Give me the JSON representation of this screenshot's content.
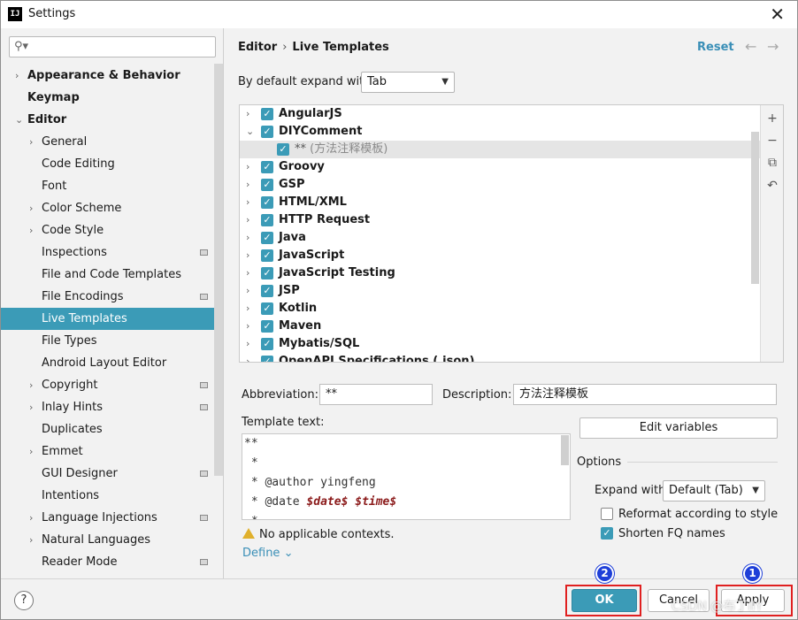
{
  "window": {
    "title": "Settings",
    "app_icon": "IJ"
  },
  "sidebar": {
    "search": {
      "placeholder": "",
      "value": ""
    },
    "items": [
      {
        "label": "Appearance & Behavior",
        "arrow": "›",
        "bold": true
      },
      {
        "label": "Keymap",
        "arrow": "",
        "bold": true
      },
      {
        "label": "Editor",
        "arrow": "⌄",
        "bold": true
      },
      {
        "label": "General",
        "arrow": "›"
      },
      {
        "label": "Code Editing",
        "arrow": ""
      },
      {
        "label": "Font",
        "arrow": ""
      },
      {
        "label": "Color Scheme",
        "arrow": "›"
      },
      {
        "label": "Code Style",
        "arrow": "›"
      },
      {
        "label": "Inspections",
        "arrow": ""
      },
      {
        "label": "File and Code Templates",
        "arrow": ""
      },
      {
        "label": "File Encodings",
        "arrow": ""
      },
      {
        "label": "Live Templates",
        "arrow": "",
        "selected": true
      },
      {
        "label": "File Types",
        "arrow": ""
      },
      {
        "label": "Android Layout Editor",
        "arrow": ""
      },
      {
        "label": "Copyright",
        "arrow": "›"
      },
      {
        "label": "Inlay Hints",
        "arrow": "›"
      },
      {
        "label": "Duplicates",
        "arrow": ""
      },
      {
        "label": "Emmet",
        "arrow": "›"
      },
      {
        "label": "GUI Designer",
        "arrow": ""
      },
      {
        "label": "Intentions",
        "arrow": ""
      },
      {
        "label": "Language Injections",
        "arrow": "›"
      },
      {
        "label": "Natural Languages",
        "arrow": "›"
      },
      {
        "label": "Reader Mode",
        "arrow": ""
      }
    ]
  },
  "header": {
    "crumb_parent": "Editor",
    "crumb_sep": "›",
    "crumb_current": "Live Templates",
    "reset": "Reset",
    "back_arrow": "←",
    "forward_arrow": "→"
  },
  "expand": {
    "label": "By default expand with",
    "value": "Tab",
    "caret": "▼"
  },
  "templates": [
    {
      "name": "AngularJS",
      "arrow": "›"
    },
    {
      "name": "DIYComment",
      "arrow": "⌄"
    },
    {
      "name": "**",
      "desc": " (方法注释模板)",
      "child": true
    },
    {
      "name": "Groovy",
      "arrow": "›"
    },
    {
      "name": "GSP",
      "arrow": "›"
    },
    {
      "name": "HTML/XML",
      "arrow": "›"
    },
    {
      "name": "HTTP Request",
      "arrow": "›"
    },
    {
      "name": "Java",
      "arrow": "›"
    },
    {
      "name": "JavaScript",
      "arrow": "›"
    },
    {
      "name": "JavaScript Testing",
      "arrow": "›"
    },
    {
      "name": "JSP",
      "arrow": "›"
    },
    {
      "name": "Kotlin",
      "arrow": "›"
    },
    {
      "name": "Maven",
      "arrow": "›"
    },
    {
      "name": "Mybatis/SQL",
      "arrow": "›"
    },
    {
      "name": "OpenAPI Specifications (.json)",
      "arrow": "›"
    }
  ],
  "tools": {
    "add": "+",
    "remove": "−",
    "copy": "⧉",
    "restore": "↶"
  },
  "abbreviation": {
    "label": "Abbreviation:",
    "value": "**"
  },
  "description": {
    "label": "Description:",
    "value": "方法注释模板"
  },
  "template_text": {
    "label": "Template text:",
    "lines": [
      "**",
      " *",
      " * @author yingfeng",
      " * @date ",
      " * "
    ],
    "date_var": "$date$",
    "time_var": "$time$"
  },
  "edit_variables": "Edit variables",
  "options": {
    "label": "Options",
    "expand_label": "Expand with",
    "expand_value": "Default (Tab)",
    "reformat": {
      "label": "Reformat according to style",
      "checked": false
    },
    "shorten": {
      "label": "Shorten FQ names",
      "checked": true
    }
  },
  "warning": "No applicable contexts.",
  "define": "Define ⌄",
  "footer": {
    "help": "?",
    "ok": "OK",
    "cancel": "Cancel",
    "apply": "Apply",
    "marker_ok": "2",
    "marker_apply": "1",
    "watermark": "CSDN @布丁IIY"
  },
  "colors": {
    "accent": "#3b9bb7",
    "link": "#3a8fb7",
    "highlight_box": "#e02020",
    "marker": "#1e3fd8"
  }
}
